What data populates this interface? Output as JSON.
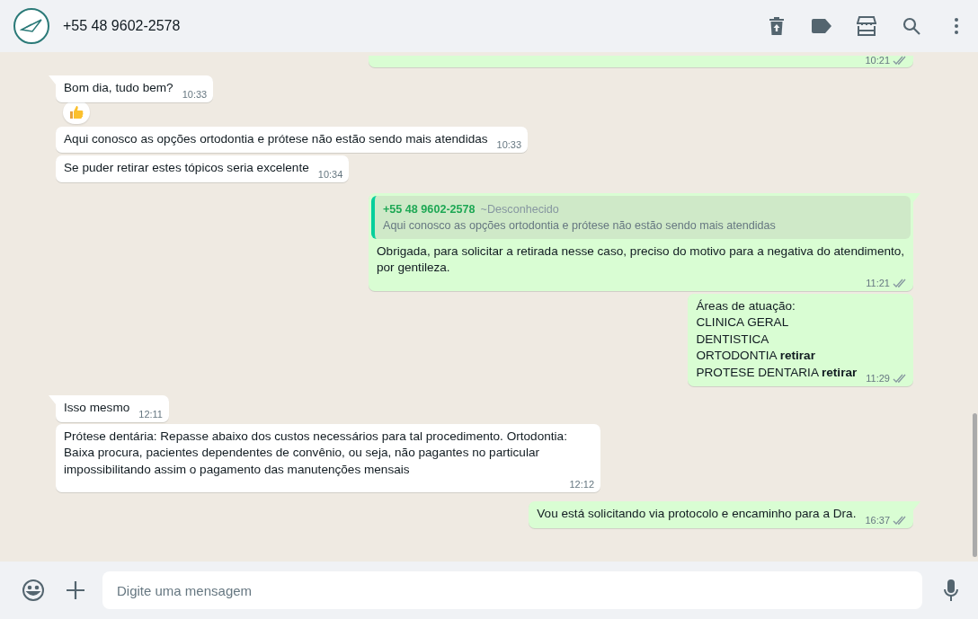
{
  "header": {
    "contact": "+55 48 9602-2578"
  },
  "messages": [
    {
      "kind": "out",
      "partial": true,
      "tail": false,
      "time": "10:21",
      "read": false
    },
    {
      "kind": "in",
      "tail": true,
      "lines": [
        "Bom dia, tudo bem?"
      ],
      "time": "10:33",
      "thumbs_up_reaction": true
    },
    {
      "kind": "in",
      "tail": false,
      "lines": [
        "Aqui conosco as opções ortodontia e prótese não estão sendo mais atendidas"
      ],
      "time": "10:33"
    },
    {
      "kind": "in",
      "tail": false,
      "lines": [
        "Se puder retirar estes tópicos seria excelente"
      ],
      "time": "10:34"
    },
    {
      "kind": "out",
      "tail": true,
      "quote": {
        "author": "+55 48 9602-2578",
        "note": "~Desconhecido",
        "text": "Aqui conosco as opções ortodontia e prótese não estão sendo mais atendidas"
      },
      "lines": [
        "Obrigada, para solicitar a retirada nesse caso, preciso do motivo para a negativa do atendimento, por gentileza."
      ],
      "time": "11:21",
      "read": false
    },
    {
      "kind": "out",
      "tail": false,
      "lines": [
        "Áreas de atuação:",
        "CLINICA GERAL",
        "DENTISTICA",
        "ORTODONTIA **retirar**",
        "PROTESE DENTARIA **retirar**"
      ],
      "time": "11:29",
      "read": false
    },
    {
      "kind": "in",
      "tail": true,
      "lines": [
        "Isso mesmo"
      ],
      "time": "12:11"
    },
    {
      "kind": "in",
      "tail": false,
      "lines": [
        "Prótese dentária: Repasse abaixo dos custos necessários para tal procedimento. Ortodontia: Baixa procura, pacientes dependentes de convênio, ou seja, não pagantes no particular impossibilitando assim o pagamento das manutenções mensais"
      ],
      "time": "12:12"
    },
    {
      "kind": "out",
      "tail": true,
      "lines": [
        "Vou está solicitando via protocolo e encaminho para a Dra."
      ],
      "time": "16:37",
      "read": false
    }
  ],
  "composer": {
    "placeholder": "Digite uma mensagem"
  }
}
